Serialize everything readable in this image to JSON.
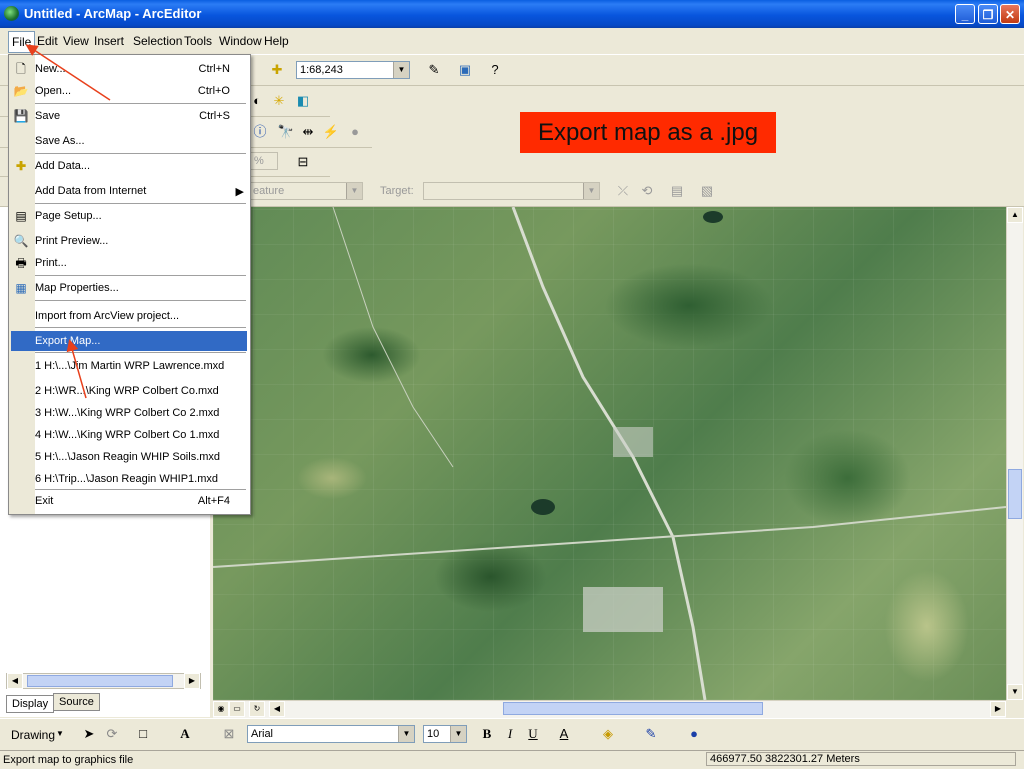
{
  "window": {
    "title": "Untitled - ArcMap - ArcEditor",
    "buttons": [
      "_",
      "❐",
      "✕"
    ]
  },
  "menubar": {
    "items": [
      "File",
      "Edit",
      "View",
      "Insert",
      "Selection",
      "Tools",
      "Window",
      "Help"
    ]
  },
  "toolbar": {
    "scale": "1:68,243",
    "editor_layer_placeholder": "eature",
    "target_label": "Target:",
    "zoom_combo": "%"
  },
  "file_menu": {
    "items": [
      {
        "label": "New...",
        "shortcut": "Ctrl+N",
        "icon": "new-document-icon"
      },
      {
        "label": "Open...",
        "shortcut": "Ctrl+O",
        "icon": "open-folder-icon"
      },
      {
        "label": "Save",
        "shortcut": "Ctrl+S",
        "icon": "save-icon"
      },
      {
        "label": "Save As...",
        "shortcut": "",
        "icon": ""
      },
      {
        "label": "Add Data...",
        "shortcut": "",
        "icon": "add-data-icon"
      },
      {
        "label": "Add Data from Internet",
        "shortcut": "",
        "icon": ""
      },
      {
        "label": "Page Setup...",
        "shortcut": "",
        "icon": "page-setup-icon"
      },
      {
        "label": "Print Preview...",
        "shortcut": "",
        "icon": "print-preview-icon"
      },
      {
        "label": "Print...",
        "shortcut": "",
        "icon": "print-icon"
      },
      {
        "label": "Map Properties...",
        "shortcut": "",
        "icon": "map-properties-icon"
      },
      {
        "label": "Import from ArcView project...",
        "shortcut": "",
        "icon": ""
      },
      {
        "label": "Export Map...",
        "shortcut": "",
        "icon": ""
      },
      {
        "label": "1 H:\\...\\Jim Martin WRP Lawrence.mxd",
        "shortcut": "",
        "icon": ""
      },
      {
        "label": "2 H:\\WR...\\King WRP Colbert Co.mxd",
        "shortcut": "",
        "icon": ""
      },
      {
        "label": "3 H:\\W...\\King WRP Colbert Co 2.mxd",
        "shortcut": "",
        "icon": ""
      },
      {
        "label": "4 H:\\W...\\King WRP Colbert Co 1.mxd",
        "shortcut": "",
        "icon": ""
      },
      {
        "label": "5 H:\\...\\Jason Reagin WHIP Soils.mxd",
        "shortcut": "",
        "icon": ""
      },
      {
        "label": "6 H:\\Trip...\\Jason Reagin WHIP1.mxd",
        "shortcut": "",
        "icon": ""
      },
      {
        "label": "Exit",
        "shortcut": "Alt+F4",
        "icon": ""
      }
    ]
  },
  "callout": {
    "text": "Export map as a .jpg",
    "color": "#FF2A00"
  },
  "toc_tabs": [
    "Display",
    "Source"
  ],
  "drawing_toolbar": {
    "drawing_label": "Drawing",
    "font": "Arial",
    "font_size": "10",
    "bold": "B",
    "italic": "I",
    "underline": "U"
  },
  "status": {
    "message": "Export map to graphics file",
    "coordinates": "466977.50  3822301.27 Meters"
  },
  "colors": {
    "highlight": "#316AC5",
    "arrow": "#E8401C",
    "titlebar": "#0855DD"
  }
}
